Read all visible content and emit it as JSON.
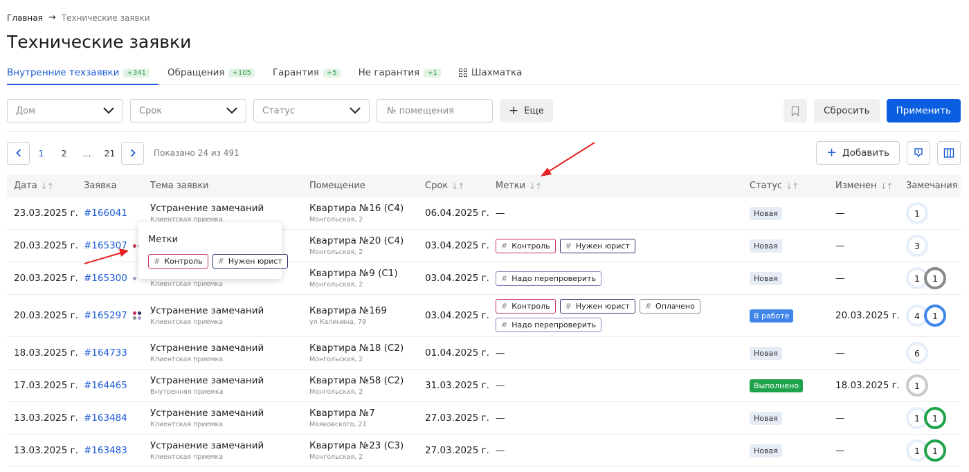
{
  "breadcrumb": {
    "home": "Главная",
    "current": "Технические заявки"
  },
  "page_title": "Технические заявки",
  "tabs": [
    {
      "label": "Внутренние техзаявки",
      "badge": "+341",
      "active": true
    },
    {
      "label": "Обращения",
      "badge": "+105"
    },
    {
      "label": "Гарантия",
      "badge": "+5"
    },
    {
      "label": "Не гарантия",
      "badge": "+1"
    },
    {
      "label": "Шахматка",
      "icon": "grid-icon"
    }
  ],
  "filters": {
    "house": "Дом",
    "deadline": "Срок",
    "status": "Статус",
    "room_placeholder": "№ помещения",
    "more": "Еще",
    "reset": "Сбросить",
    "apply": "Применить"
  },
  "pagination": {
    "pages": [
      "1",
      "2",
      "...",
      "21"
    ],
    "info": "Показано 24 из 491"
  },
  "toolbar": {
    "add": "Добавить"
  },
  "columns": {
    "date": "Дата",
    "request": "Заявка",
    "topic": "Тема заявки",
    "room": "Помещение",
    "deadline": "Срок",
    "tags": "Метки",
    "status": "Статус",
    "changed": "Изменен",
    "remarks": "Замечания"
  },
  "colors": {
    "accent": "#1b5bd6",
    "tag_control": "#c4304f",
    "tag_lawyer": "#2c2f6d",
    "tag_paid": "#8a8a8a",
    "tag_recheck": "#8a7fbd",
    "status_new_bg": "#e5ecf6",
    "status_work": "#3f86e8",
    "status_done": "#1fa34a"
  },
  "rows": [
    {
      "date": "23.03.2025 г.",
      "id": "#166041",
      "topic": "Устранение замечаний",
      "topic_sub": "Клиентская приемка",
      "room": "Квартира №16 (С4)",
      "address": "Монгольская, 2",
      "deadline": "06.04.2025 г.",
      "tags_empty": "—",
      "status": "Новая",
      "changed": "—",
      "remark1": "1",
      "remark2": ""
    },
    {
      "date": "20.03.2025 г.",
      "id": "#165307",
      "topic": "",
      "topic_sub": "",
      "room": "Квартира №20 (С4)",
      "address": "Монгольская, 2",
      "deadline": "03.04.2025 г.",
      "tag1": "Контроль",
      "tag2": "Нужен юрист",
      "status": "Новая",
      "changed": "—",
      "remark1": "3",
      "remark2": ""
    },
    {
      "date": "20.03.2025 г.",
      "id": "#165300",
      "topic": "",
      "topic_sub": "Клиентская приемка",
      "room": "Квартира №9 (С1)",
      "address": "Монгольская, 2",
      "deadline": "03.04.2025 г.",
      "tag1": "Надо перепроверить",
      "status": "Новая",
      "changed": "—",
      "remark1": "1",
      "remark2": "1"
    },
    {
      "date": "20.03.2025 г.",
      "id": "#165297",
      "topic": "Устранение замечаний",
      "topic_sub": "Клиентская приемка",
      "room": "Квартира №169",
      "address": "ул Калинина, 79",
      "deadline": "03.04.2025 г.",
      "tag1": "Контроль",
      "tag2": "Нужен юрист",
      "tag3": "Оплачено",
      "tag4": "Надо перепроверить",
      "status": "В работе",
      "changed": "20.03.2025 г.",
      "remark1": "4",
      "remark2": "1"
    },
    {
      "date": "18.03.2025 г.",
      "id": "#164733",
      "topic": "Устранение замечаний",
      "topic_sub": "Клиентская приемка",
      "room": "Квартира №18 (С2)",
      "address": "Монгольская, 2",
      "deadline": "01.04.2025 г.",
      "tags_empty": "—",
      "status": "Новая",
      "changed": "—",
      "remark1": "6",
      "remark2": ""
    },
    {
      "date": "17.03.2025 г.",
      "id": "#164465",
      "topic": "Устранение замечаний",
      "topic_sub": "Внутренняя приемка",
      "room": "Квартира №58 (С2)",
      "address": "Монгольская, 2",
      "deadline": "31.03.2025 г.",
      "tags_empty": "—",
      "status": "Выполнено",
      "changed": "18.03.2025 г.",
      "remark1": "1",
      "remark2": ""
    },
    {
      "date": "13.03.2025 г.",
      "id": "#163484",
      "topic": "Устранение замечаний",
      "topic_sub": "Клиентская приемка",
      "room": "Квартира №7",
      "address": "Маяковского, 21",
      "deadline": "27.03.2025 г.",
      "tags_empty": "—",
      "status": "Новая",
      "changed": "—",
      "remark1": "1",
      "remark2": "1"
    },
    {
      "date": "13.03.2025 г.",
      "id": "#163483",
      "topic": "Устранение замечаний",
      "topic_sub": "Клиентская приемка",
      "room": "Квартира №23 (С3)",
      "address": "Монгольская, 2",
      "deadline": "27.03.2025 г.",
      "tags_empty": "—",
      "status": "Новая",
      "changed": "—",
      "remark1": "1",
      "remark2": "1"
    }
  ],
  "popover": {
    "title": "Метки",
    "tag1": "Контроль",
    "tag2": "Нужен юрист"
  }
}
